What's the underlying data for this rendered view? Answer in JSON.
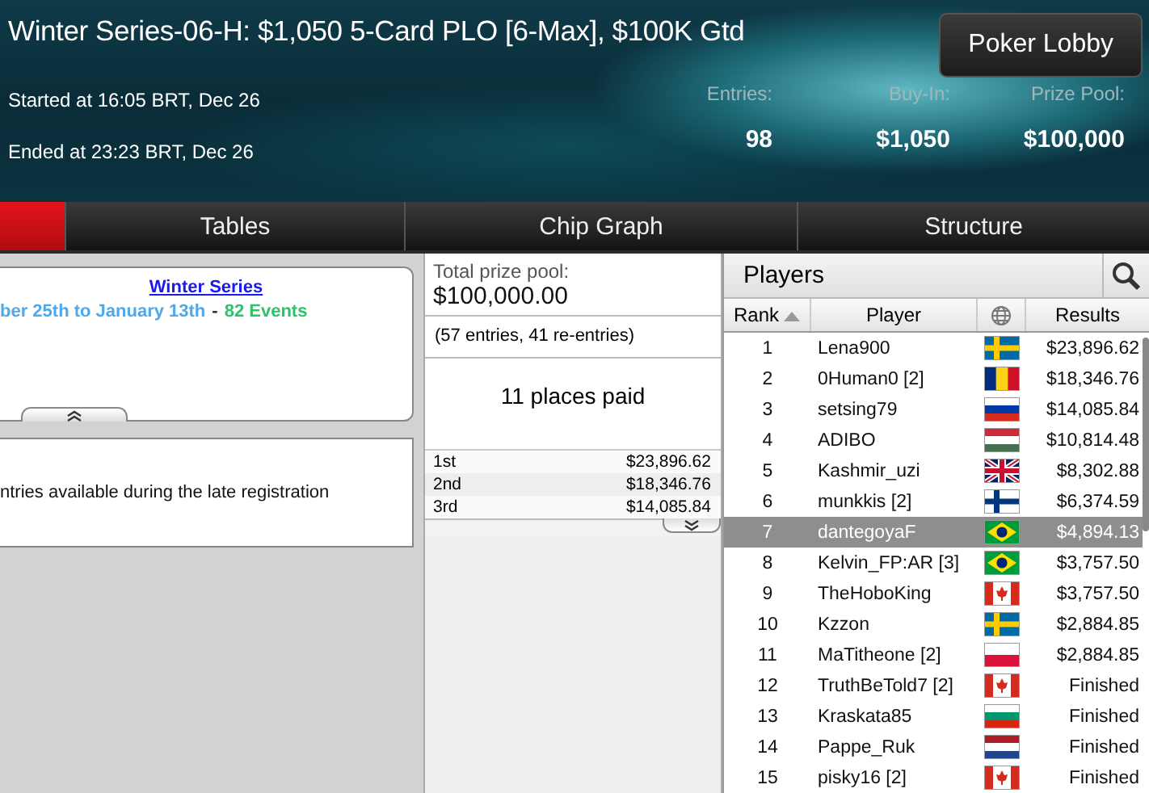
{
  "header": {
    "title": "Winter Series-06-H: $1,050 5-Card PLO [6-Max], $100K Gtd",
    "lobby_button": "Poker Lobby",
    "started": "Started at 16:05 BRT, Dec 26",
    "ended": "Ended at 23:23 BRT, Dec 26",
    "stats": [
      {
        "label": "Entries:",
        "value": "98"
      },
      {
        "label": "Buy-In:",
        "value": "$1,050"
      },
      {
        "label": "Prize Pool:",
        "value": "$100,000"
      }
    ]
  },
  "tabs": [
    {
      "selected": true
    },
    {
      "label": "Tables",
      "selected": false
    },
    {
      "label": "Chip Graph",
      "selected": false
    },
    {
      "label": "Structure",
      "selected": false
    }
  ],
  "series_card": {
    "link": "Winter Series",
    "dates": "ber 25th to January 13th",
    "separator": "-",
    "events": "82 Events"
  },
  "info_card": {
    "text": "ntries available during the late registration"
  },
  "prizes": {
    "label": "Total prize pool:",
    "total": "$100,000.00",
    "entries": "(57 entries, 41 re-entries)",
    "paid": "11 places paid",
    "places": [
      {
        "place": "1st",
        "amount": "$23,896.62"
      },
      {
        "place": "2nd",
        "amount": "$18,346.76"
      },
      {
        "place": "3rd",
        "amount": "$14,085.84"
      }
    ]
  },
  "players": {
    "title": "Players",
    "columns": [
      "Rank",
      "Player",
      "Results"
    ],
    "rows": [
      {
        "rank": "1",
        "player": "Lena900",
        "kind": "sweden",
        "result": "$23,896.62",
        "selected": false
      },
      {
        "rank": "2",
        "player": "0Human0 [2]",
        "kind": "romania",
        "result": "$18,346.76",
        "selected": false
      },
      {
        "rank": "3",
        "player": "setsing79",
        "kind": "russia",
        "result": "$14,085.84",
        "selected": false
      },
      {
        "rank": "4",
        "player": "ADIBO",
        "kind": "hungary",
        "result": "$10,814.48",
        "selected": false
      },
      {
        "rank": "5",
        "player": "Kashmir_uzi",
        "kind": "uk",
        "result": "$8,302.88",
        "selected": false
      },
      {
        "rank": "6",
        "player": "munkkis [2]",
        "kind": "finland",
        "result": "$6,374.59",
        "selected": false
      },
      {
        "rank": "7",
        "player": "dantegoyaF",
        "kind": "brazil",
        "result": "$4,894.13",
        "selected": true
      },
      {
        "rank": "8",
        "player": "Kelvin_FP:AR [3]",
        "kind": "brazil",
        "result": "$3,757.50",
        "selected": false
      },
      {
        "rank": "9",
        "player": "TheHoboKing",
        "kind": "canada",
        "result": "$3,757.50",
        "selected": false
      },
      {
        "rank": "10",
        "player": "Kzzon",
        "kind": "sweden",
        "result": "$2,884.85",
        "selected": false
      },
      {
        "rank": "11",
        "player": "MaTitheone [2]",
        "kind": "poland",
        "result": "$2,884.85",
        "selected": false
      },
      {
        "rank": "12",
        "player": "TruthBeTold7 [2]",
        "kind": "canada",
        "result": "Finished",
        "selected": false
      },
      {
        "rank": "13",
        "player": "Kraskata85",
        "kind": "bulgaria",
        "result": "Finished",
        "selected": false
      },
      {
        "rank": "14",
        "player": "Pappe_Ruk",
        "kind": "netherlands",
        "result": "Finished",
        "selected": false
      },
      {
        "rank": "15",
        "player": "pisky16 [2]",
        "kind": "canada",
        "result": "Finished",
        "selected": false
      }
    ]
  }
}
